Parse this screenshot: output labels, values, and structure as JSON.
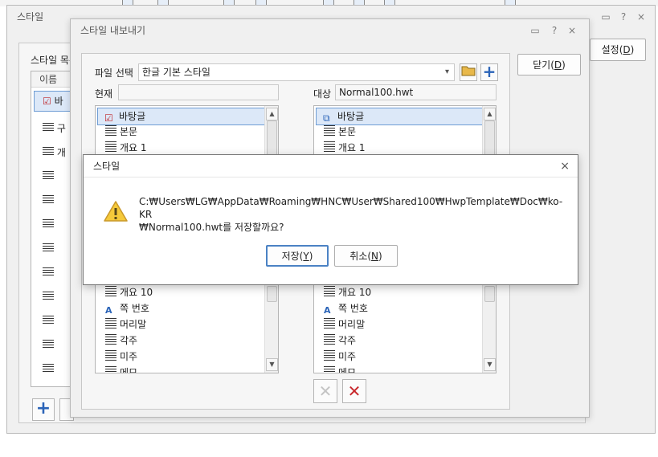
{
  "bg_window": {
    "title": "스타일",
    "style_list_label": "스타일 목록",
    "column_name": "이름",
    "first_item_label": "바",
    "item2_char": "구",
    "item3_char": "개",
    "settings_label": "설정(",
    "settings_key": "D",
    "settings_close": ")"
  },
  "export_window": {
    "title": "스타일 내보내기",
    "close_label": "닫기(",
    "close_key": "D",
    "close_close": ")",
    "file_select_label": "파일 선택",
    "file_select_value": "한글 기본 스타일",
    "current_label": "현재",
    "current_value": "",
    "target_label": "대상",
    "target_value": "Normal100.hwt",
    "left_list": [
      "바탕글",
      "본문",
      "개요 1",
      "개요 10",
      "쪽 번호",
      "머리말",
      "각주",
      "미주",
      "메모"
    ],
    "right_list": [
      "바탕글",
      "본문",
      "개요 1",
      "개요 10",
      "쪽 번호",
      "머리말",
      "각주",
      "미주",
      "메모"
    ]
  },
  "dialog": {
    "title": "스타일",
    "message_line1": "C:₩Users₩LG₩AppData₩Roaming₩HNC₩User₩Shared100₩HwpTemplate₩Doc₩ko-KR",
    "message_line2": "₩Normal100.hwt를 저장할까요?",
    "save_label": "저장(",
    "save_key": "Y",
    "save_close": ")",
    "cancel_label": "취소(",
    "cancel_key": "N",
    "cancel_close": ")"
  },
  "icons": {
    "help": "?",
    "close": "×",
    "chevron": "▾",
    "scroll_up": "▲",
    "scroll_down": "▼",
    "plus": "+",
    "delete": "✕",
    "warning_mark": "!"
  }
}
